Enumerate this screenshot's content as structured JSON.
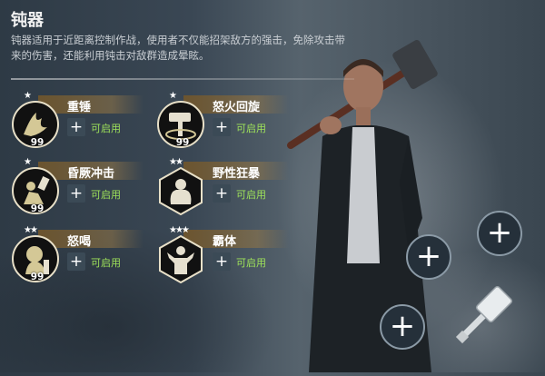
{
  "header": {
    "title": "钝器",
    "description": "钝器适用于近距离控制作战，使用者不仅能招架敌方的强击，免除攻击带来的伤害，还能利用钝击对敌群造成晕眩。"
  },
  "skills": [
    {
      "name": "重锤",
      "stars": "★",
      "level": "99",
      "status": "可启用",
      "plus": "+",
      "icon": "heavy-hammer-icon"
    },
    {
      "name": "怒火回旋",
      "stars": "★",
      "level": "99",
      "status": "可启用",
      "plus": "+",
      "icon": "rage-spin-icon"
    },
    {
      "name": "昏厥冲击",
      "stars": "★",
      "level": "99",
      "status": "可启用",
      "plus": "+",
      "icon": "stun-strike-icon"
    },
    {
      "name": "野性狂暴",
      "stars": "★★",
      "level": "",
      "status": "可启用",
      "plus": "+",
      "icon": "wild-rage-icon"
    },
    {
      "name": "怒喝",
      "stars": "★★",
      "level": "99",
      "status": "可启用",
      "plus": "+",
      "icon": "war-cry-icon"
    },
    {
      "name": "霸体",
      "stars": "★★★",
      "level": "",
      "status": "可启用",
      "plus": "+",
      "icon": "super-armor-icon"
    }
  ],
  "slots": {
    "plus": "+",
    "weapon_icon": "sledgehammer-icon"
  },
  "colors": {
    "available": "#9fe35a",
    "name_bar": "#6e552d",
    "background": "#3a4754"
  }
}
